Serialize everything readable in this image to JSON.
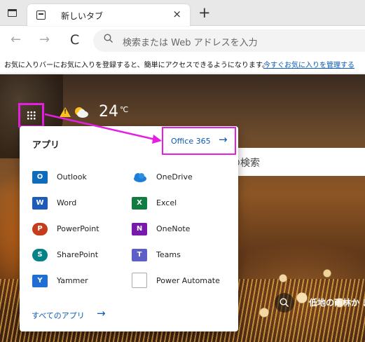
{
  "browser": {
    "tab_title": "新しいタブ",
    "tab_close": "×",
    "new_tab": "+",
    "nav": {
      "back": "←",
      "forward": "→",
      "refresh": "C"
    },
    "address_placeholder": "検索または Web アドレスを入力"
  },
  "favbar": {
    "message": "お気に入りバーにお気に入りを登録すると、簡単にアクセスできるようになります。",
    "link": "今すぐお気に入りを管理する"
  },
  "weather": {
    "temperature": "24",
    "unit": "℃",
    "icon": "partly-cloudy-icon",
    "alert_icon": "warning-icon"
  },
  "search": {
    "placeholder_visible": "の検索"
  },
  "apps_panel": {
    "title": "アプリ",
    "office_link": "Office 365",
    "office_arrow": "→",
    "apps": [
      {
        "label": "Outlook",
        "icon": "outlook-icon",
        "color": "#0f6cbd"
      },
      {
        "label": "OneDrive",
        "icon": "onedrive-icon",
        "color": "#1c7ed6"
      },
      {
        "label": "Word",
        "icon": "word-icon",
        "color": "#1e5bb8"
      },
      {
        "label": "Excel",
        "icon": "excel-icon",
        "color": "#107c41"
      },
      {
        "label": "PowerPoint",
        "icon": "powerpoint-icon",
        "color": "#c43e1c"
      },
      {
        "label": "OneNote",
        "icon": "onenote-icon",
        "color": "#7719aa"
      },
      {
        "label": "SharePoint",
        "icon": "sharepoint-icon",
        "color": "#038387"
      },
      {
        "label": "Teams",
        "icon": "teams-icon",
        "color": "#5b5fc7"
      },
      {
        "label": "Yammer",
        "icon": "yammer-icon",
        "color": "#1f6ed4"
      },
      {
        "label": "Power Automate",
        "icon": "power-automate-icon",
        "color": "#ffffff"
      }
    ],
    "all_apps": "すべてのアプリ",
    "all_apps_arrow": "→"
  },
  "news": {
    "headline": "低地の雨林か まで..."
  },
  "colors": {
    "highlight": "#e61ee1",
    "link": "#0a5ab4"
  }
}
